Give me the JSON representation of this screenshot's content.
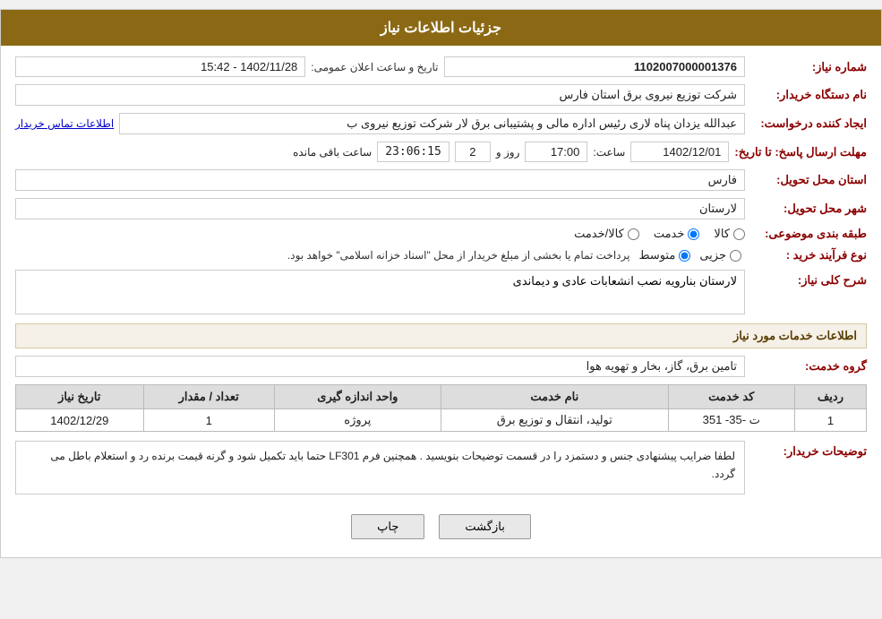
{
  "header": {
    "title": "جزئیات اطلاعات نیاز"
  },
  "fields": {
    "shomara_niaz_label": "شماره نیاز:",
    "shomara_niaz_value": "1102007000001376",
    "nam_dastgah_label": "نام دستگاه خریدار:",
    "nam_dastgah_value": "شرکت توزیع نیروی برق استان فارس",
    "ijad_konande_label": "ایجاد کننده درخواست:",
    "ijad_konande_value": "عبدالله یزدان پناه لاری رئیس اداره مالی و پشتیبانی برق لار شرکت توزیع نیروی ب",
    "ijad_konande_link": "اطلاعات تماس خریدار",
    "mohlat_label": "مهلت ارسال پاسخ: تا تاریخ:",
    "mohlat_date": "1402/12/01",
    "mohlat_time_label": "ساعت:",
    "mohlat_time": "17:00",
    "mohlat_roz_label": "روز و",
    "mohlat_roz_value": "2",
    "mohlat_saat_mande_label": "ساعت باقی مانده",
    "mohlat_countdown": "23:06:15",
    "ostan_label": "استان محل تحویل:",
    "ostan_value": "فارس",
    "shahr_label": "شهر محل تحویل:",
    "shahr_value": "لارستان",
    "tabaqe_label": "طبقه بندی موضوعی:",
    "tabaqe_radio1": "کالا",
    "tabaqe_radio2": "خدمت",
    "tabaqe_radio3": "کالا/خدمت",
    "tabaqe_selected": "خدمت",
    "no_farayand_label": "نوع فرآیند خرید :",
    "no_farayand_radio1": "جزیی",
    "no_farayand_radio2": "متوسط",
    "no_farayand_text": "پرداخت تمام یا بخشی از مبلغ خریدار از محل \"اسناد خزانه اسلامی\" خواهد بود.",
    "sharh_label": "شرح کلی نیاز:",
    "sharh_value": "لارستان بنارویه نصب انشعابات عادی و دیماندی",
    "khadamat_header": "اطلاعات خدمات مورد نیاز",
    "goroh_khedmat_label": "گروه خدمت:",
    "goroh_khedmat_value": "تامین برق، گاز، بخار و تهویه هوا",
    "table_headers": [
      "ردیف",
      "کد خدمت",
      "نام خدمت",
      "واحد اندازه گیری",
      "تعداد / مقدار",
      "تاریخ نیاز"
    ],
    "table_rows": [
      {
        "radif": "1",
        "kod_khedmat": "ت -35- 351",
        "nam_khedmat": "تولید، انتقال و توزیع برق",
        "vahed": "پروژه",
        "tedad": "1",
        "tarikh": "1402/12/29"
      }
    ],
    "tozihat_label": "توضیحات خریدار:",
    "tozihat_value": "لطفا ضرایب پیشنهادی جنس و دستمزد را در قسمت توضیحات بنویسید . همچنین فرم LF301 حتما باید تکمیل شود و گرنه قیمت برنده رد و استعلام باطل می گردد.",
    "announce_label": "تاریخ و ساعت اعلان عمومی:",
    "announce_value": "1402/11/28 - 15:42",
    "btn_back": "بازگشت",
    "btn_print": "چاپ"
  }
}
